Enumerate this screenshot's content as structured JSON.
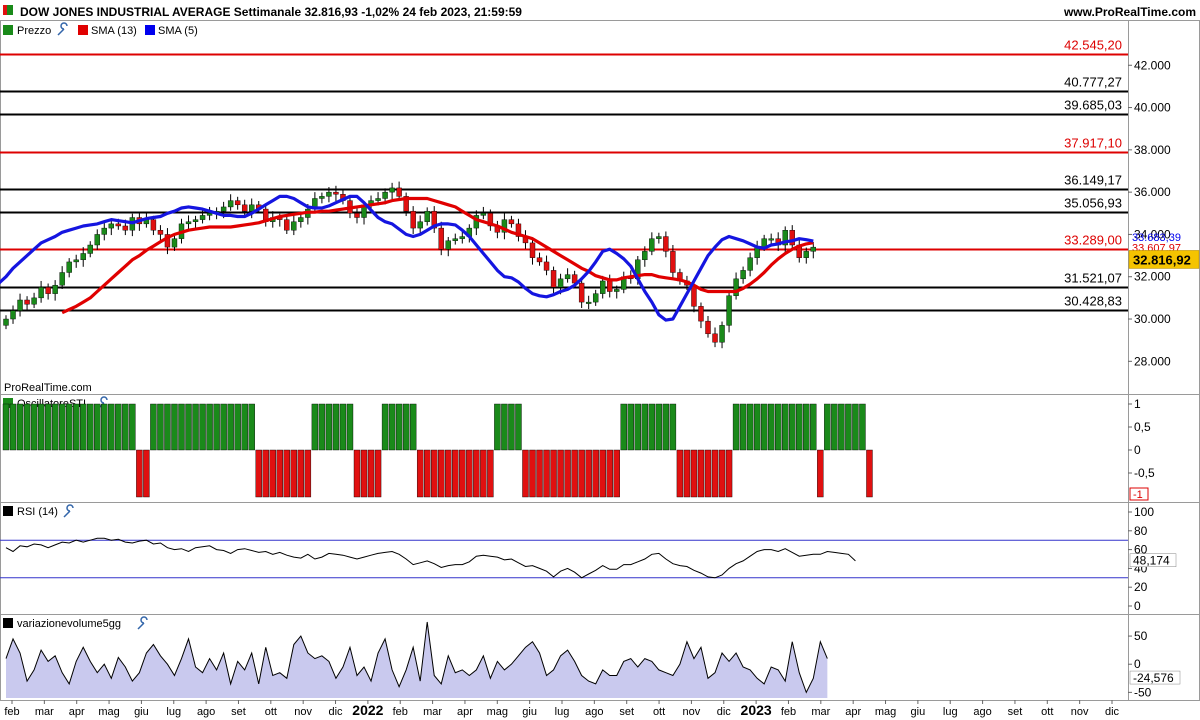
{
  "header": {
    "title": "DOW JONES INDUSTRIAL AVERAGE Settimanale 32.816,93 -1,02% 24 feb 2023, 21:59:59",
    "brand": "www.ProRealTime.com"
  },
  "watermark": "ProRealTime.com",
  "legend": [
    {
      "label": "Prezzo",
      "color": "#1a7a1a",
      "tool": "wrench-icon"
    },
    {
      "label": "SMA (13)",
      "color": "#e00000"
    },
    {
      "label": "SMA (5)",
      "color": "#0000ee"
    }
  ],
  "colors": {
    "up": "#1a8a1a",
    "down": "#e01010",
    "sma13": "#e00000",
    "sma5": "#1515e0",
    "price_tag": "#f5c400",
    "red_level": "#dd0000"
  },
  "chart_data": [
    {
      "type": "candlestick",
      "title": "DOW JONES INDUSTRIAL AVERAGE Settimanale",
      "ylim": [
        27400,
        43100
      ],
      "y_ticks": [
        "28.000",
        "30.000",
        "32.000",
        "34.000",
        "36.000",
        "38.000",
        "40.000",
        "42.000"
      ],
      "y_tick_values": [
        28000,
        30000,
        32000,
        34000,
        36000,
        38000,
        40000,
        42000
      ],
      "last_price": 32816.92,
      "last_price_label": "32.816,92",
      "sma_labels": [
        {
          "text": "33.683,39",
          "value": 33683.39,
          "color": "#0000ee"
        },
        {
          "text": "33.607,97",
          "value": 33607.97,
          "color": "#dd0000"
        }
      ],
      "levels": [
        {
          "value": 42545.2,
          "label": "42.545,20",
          "color": "#dd0000"
        },
        {
          "value": 40777.27,
          "label": "40.777,27",
          "color": "#000000"
        },
        {
          "value": 39685.03,
          "label": "39.685,03",
          "color": "#000000"
        },
        {
          "value": 37917.1,
          "label": "37.917,10",
          "color": "#dd0000"
        },
        {
          "value": 36149.17,
          "label": "36.149,17",
          "color": "#000000"
        },
        {
          "value": 35056.93,
          "label": "35.056,93",
          "color": "#000000"
        },
        {
          "value": 33289.0,
          "label": "33.289,00",
          "color": "#dd0000"
        },
        {
          "value": 31521.07,
          "label": "31.521,07",
          "color": "#000000"
        },
        {
          "value": 30428.83,
          "label": "30.428,83",
          "color": "#000000"
        }
      ],
      "x_labels": [
        "feb",
        "mar",
        "apr",
        "mag",
        "giu",
        "lug",
        "ago",
        "set",
        "ott",
        "nov",
        "dic",
        "2022",
        "feb",
        "mar",
        "apr",
        "mag",
        "giu",
        "lug",
        "ago",
        "set",
        "ott",
        "nov",
        "dic",
        "2023",
        "feb",
        "mar",
        "apr",
        "mag",
        "giu",
        "lug",
        "ago",
        "set",
        "ott",
        "nov",
        "dic"
      ],
      "x_bold": [
        "2022",
        "2023"
      ],
      "week_count": 116,
      "closes": [
        30000,
        30400,
        30900,
        30700,
        31000,
        31500,
        31200,
        31600,
        32200,
        32700,
        32800,
        33100,
        33500,
        34000,
        34300,
        34500,
        34400,
        34200,
        34800,
        34500,
        34700,
        34200,
        34000,
        33400,
        33800,
        34500,
        34600,
        34700,
        34900,
        35000,
        35100,
        35300,
        35600,
        35400,
        35100,
        35400,
        35200,
        34600,
        34800,
        34700,
        34200,
        34600,
        34800,
        35200,
        35700,
        35800,
        36000,
        35900,
        35600,
        35000,
        34800,
        35400,
        35600,
        35700,
        36000,
        36200,
        35800,
        35100,
        34300,
        34600,
        35100,
        34300,
        33300,
        33700,
        33800,
        33900,
        34300,
        34900,
        35000,
        34400,
        34100,
        34700,
        34500,
        33900,
        33600,
        32900,
        32700,
        32300,
        31500,
        31900,
        32100,
        31700,
        30800,
        30800,
        31200,
        31800,
        31300,
        31400,
        32000,
        31900,
        32800,
        33200,
        33800,
        33900,
        33200,
        32200,
        31800,
        31600,
        30600,
        29900,
        29300,
        28900,
        29700,
        31100,
        31900,
        32300,
        32900,
        33400,
        33800,
        33800,
        33500,
        34200,
        33500,
        32900,
        33200,
        33400,
        33300,
        33900,
        33900,
        33700,
        33900,
        33800,
        33200,
        32817
      ],
      "sma5": [
        30700,
        30750,
        30800,
        31000,
        31300,
        31700,
        32000,
        32400,
        32700,
        33000,
        33300,
        33600,
        33750,
        33900,
        34100,
        34200,
        34300,
        34400,
        34450,
        34500,
        34600,
        34700,
        34650,
        34600,
        34550,
        34650,
        34750,
        34800,
        34850,
        35000,
        35100,
        35250,
        35300,
        35250,
        35200,
        35100,
        35000,
        34900,
        34900,
        34850,
        34850,
        35000,
        35200,
        35400,
        35600,
        35800,
        35800,
        35700,
        35500,
        35300,
        35250,
        35250,
        35350,
        35500,
        35650,
        35800,
        35800,
        35500,
        35150,
        34800,
        34600,
        34500,
        34250,
        34000,
        33900,
        34000,
        34200,
        34400,
        34500,
        34500,
        34450,
        34200,
        33900,
        33500,
        33100,
        32700,
        32300,
        32000,
        31950,
        31750,
        31450,
        31200,
        31100,
        31050,
        31150,
        31300,
        31400,
        31600,
        31900,
        32250,
        32700,
        33200,
        33300,
        33100,
        32850,
        32500,
        31900,
        31300,
        30800,
        30200,
        29950,
        30000,
        30600,
        31200,
        31800,
        32400,
        33000,
        33400,
        33750,
        33900,
        33800,
        33700,
        33550,
        33400,
        33350,
        33500,
        33550,
        33650,
        33700,
        33800,
        33750,
        33683
      ],
      "sma13": [
        30300,
        30450,
        30600,
        30800,
        31000,
        31300,
        31600,
        31900,
        32200,
        32500,
        32800,
        33000,
        33250,
        33450,
        33650,
        33850,
        34000,
        34100,
        34200,
        34250,
        34300,
        34350,
        34350,
        34350,
        34350,
        34400,
        34450,
        34500,
        34550,
        34650,
        34750,
        34850,
        34900,
        34950,
        35000,
        35050,
        35050,
        35100,
        35100,
        35150,
        35200,
        35250,
        35300,
        35350,
        35400,
        35450,
        35500,
        35600,
        35650,
        35700,
        35700,
        35700,
        35700,
        35600,
        35500,
        35400,
        35300,
        35100,
        34900,
        34700,
        34600,
        34500,
        34400,
        34250,
        34100,
        34000,
        33900,
        33800,
        33600,
        33400,
        33200,
        33000,
        32800,
        32600,
        32400,
        32250,
        32050,
        31950,
        31850,
        31850,
        31950,
        32000,
        32050,
        32100,
        32100,
        32000,
        31950,
        31900,
        31850,
        31750,
        31600,
        31400,
        31300,
        31300,
        31300,
        31300,
        31300,
        31450,
        31650,
        31900,
        32200,
        32550,
        32850,
        33100,
        33300,
        33450,
        33550,
        33608
      ]
    },
    {
      "type": "bar",
      "title": "OscillatoreSTI",
      "ylim": [
        -1,
        1
      ],
      "y_ticks": [
        "1",
        "0,5",
        "0",
        "-0,5"
      ],
      "y_tick_values": [
        1,
        0.5,
        0,
        -0.5
      ],
      "last_label": "-1",
      "values": [
        1,
        1,
        1,
        1,
        1,
        1,
        1,
        1,
        1,
        1,
        1,
        1,
        1,
        1,
        1,
        1,
        1,
        1,
        1,
        -1,
        -1,
        1,
        1,
        1,
        1,
        1,
        1,
        1,
        1,
        1,
        1,
        1,
        1,
        1,
        1,
        1,
        -1,
        -1,
        -1,
        -1,
        -1,
        -1,
        -1,
        -1,
        1,
        1,
        1,
        1,
        1,
        1,
        -1,
        -1,
        -1,
        -1,
        1,
        1,
        1,
        1,
        1,
        -1,
        -1,
        -1,
        -1,
        -1,
        -1,
        -1,
        -1,
        -1,
        -1,
        -1,
        1,
        1,
        1,
        1,
        -1,
        -1,
        -1,
        -1,
        -1,
        -1,
        -1,
        -1,
        -1,
        -1,
        -1,
        -1,
        -1,
        -1,
        1,
        1,
        1,
        1,
        1,
        1,
        1,
        1,
        -1,
        -1,
        -1,
        -1,
        -1,
        -1,
        -1,
        -1,
        1,
        1,
        1,
        1,
        1,
        1,
        1,
        1,
        1,
        1,
        1,
        1,
        -1,
        1,
        1,
        1,
        1,
        1,
        1,
        -1
      ]
    },
    {
      "type": "line",
      "title": "RSI (14)",
      "ylim": [
        0,
        100
      ],
      "y_ticks": [
        "100",
        "80",
        "60",
        "40",
        "20",
        "0"
      ],
      "y_tick_values": [
        100,
        80,
        60,
        40,
        20,
        0
      ],
      "bands": [
        70,
        30
      ],
      "last_label": "48,174",
      "last_value": 48.174,
      "values": [
        62,
        58,
        64,
        63,
        66,
        65,
        62,
        65,
        68,
        67,
        70,
        68,
        70,
        72,
        72,
        70,
        71,
        68,
        67,
        69,
        70,
        66,
        67,
        62,
        60,
        61,
        58,
        62,
        63,
        64,
        60,
        59,
        56,
        60,
        61,
        59,
        57,
        58,
        55,
        57,
        54,
        52,
        51,
        55,
        50,
        52,
        56,
        55,
        54,
        52,
        50,
        52,
        54,
        56,
        57,
        58,
        55,
        50,
        44,
        46,
        48,
        45,
        41,
        43,
        44,
        44,
        47,
        53,
        54,
        53,
        52,
        49,
        50,
        46,
        42,
        43,
        40,
        37,
        31,
        37,
        40,
        36,
        30,
        34,
        38,
        43,
        39,
        39,
        44,
        44,
        47,
        50,
        55,
        56,
        50,
        45,
        43,
        42,
        38,
        35,
        31,
        30,
        33,
        40,
        45,
        48,
        53,
        58,
        60,
        60,
        58,
        61,
        57,
        53,
        54,
        55,
        55,
        58,
        57,
        56,
        55,
        48
      ]
    },
    {
      "type": "area",
      "title": "variazionevolume5gg",
      "ylim": [
        -60,
        75
      ],
      "y_ticks": [
        "50",
        "0",
        "-50"
      ],
      "y_tick_values": [
        50,
        0,
        -50
      ],
      "last_label": "-24,576",
      "last_value": -24.576,
      "values": [
        10,
        45,
        20,
        -30,
        -10,
        25,
        5,
        15,
        -15,
        -35,
        5,
        30,
        5,
        -15,
        0,
        -25,
        12,
        -5,
        -30,
        -15,
        20,
        35,
        15,
        0,
        -20,
        10,
        45,
        -5,
        -15,
        10,
        -10,
        20,
        -35,
        5,
        -10,
        20,
        -35,
        30,
        -20,
        -15,
        -25,
        35,
        50,
        20,
        10,
        15,
        5,
        -25,
        -5,
        30,
        -20,
        -5,
        -30,
        20,
        45,
        -10,
        -40,
        -10,
        30,
        -30,
        75,
        -20,
        -35,
        15,
        -15,
        -10,
        -20,
        -10,
        15,
        -25,
        5,
        -10,
        0,
        15,
        30,
        40,
        20,
        -20,
        -10,
        15,
        25,
        5,
        -20,
        -30,
        -35,
        -10,
        -20,
        -20,
        5,
        10,
        -5,
        10,
        5,
        -10,
        -15,
        -20,
        0,
        40,
        10,
        30,
        -25,
        -15,
        20,
        5,
        20,
        -5,
        -10,
        -25,
        -35,
        -5,
        -10,
        -30,
        40,
        -15,
        -50,
        -25,
        40,
        10
      ]
    }
  ]
}
